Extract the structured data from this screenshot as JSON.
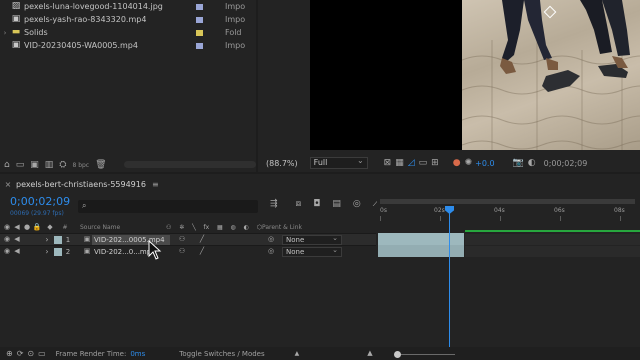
{
  "project": {
    "items": [
      {
        "name": "pexels-luna-lovegood-1104014.jpg",
        "type": "Impo",
        "label_color": "#9aa6d6",
        "icon": "image-icon",
        "expandable": false
      },
      {
        "name": "pexels-yash-rao-8343320.mp4",
        "type": "Impo",
        "label_color": "#9aa6d6",
        "icon": "footage-icon",
        "expandable": false
      },
      {
        "name": "Solids",
        "type": "Fold",
        "label_color": "#d8c658",
        "icon": "folder-icon",
        "expandable": true
      },
      {
        "name": "VID-20230405-WA0005.mp4",
        "type": "Impo",
        "label_color": "#9aa6d6",
        "icon": "footage-icon",
        "expandable": false
      }
    ],
    "bpc": "8 bpc"
  },
  "viewer": {
    "zoom": "(88.7%)",
    "resolution": "Full",
    "exposure": "+0.0",
    "timecode": "0;00;02;09"
  },
  "timeline": {
    "comp_name": "pexels-bert-christiaens-5594916",
    "timecode": "0;00;02;09",
    "fps": "00069 (29.97 fps)",
    "search_placeholder": "",
    "header": {
      "num": "#",
      "source": "Source Name",
      "parent": "Parent & Link"
    },
    "layers": [
      {
        "num": "1",
        "source": "VID-202...0005.mp4",
        "parent": "None",
        "label_color": "#9db8bd",
        "selected": true
      },
      {
        "num": "2",
        "source": "VID-202...0...mp4",
        "parent": "None",
        "label_color": "#9db8bd",
        "selected": false
      }
    ],
    "ruler": [
      "0s",
      "02s",
      "04s",
      "06s",
      "08s"
    ],
    "current_time_seconds": 2.3,
    "footer": {
      "frame_render_label": "Frame Render Time:",
      "frame_render_value": "0ms",
      "toggle_label": "Toggle Switches / Modes"
    }
  }
}
